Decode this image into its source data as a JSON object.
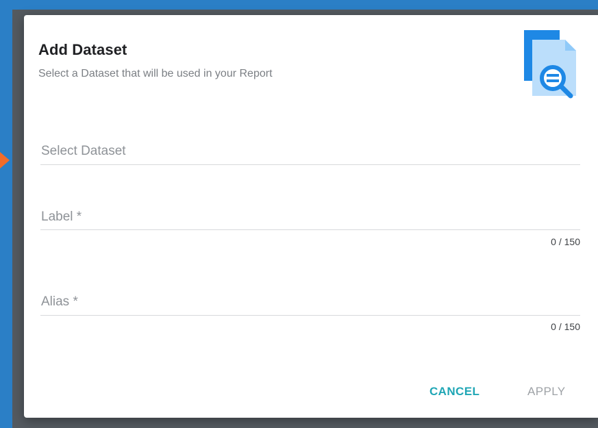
{
  "dialog": {
    "title": "Add Dataset",
    "subtitle": "Select a Dataset that will be used in your Report",
    "icon": "dataset-search-icon"
  },
  "fields": {
    "dataset": {
      "placeholder": "Select Dataset",
      "value": ""
    },
    "label": {
      "placeholder": "Label *",
      "value": "",
      "counter": "0 / 150"
    },
    "alias": {
      "placeholder": "Alias *",
      "value": "",
      "counter": "0 / 150"
    }
  },
  "actions": {
    "cancel_label": "CANCEL",
    "apply_label": "APPLY"
  },
  "colors": {
    "accent": "#1fa6b5",
    "disabled": "#9ea2a6",
    "icon_blue": "#1e88e5",
    "background_blue": "#2b7fc6",
    "background_orange": "#f26c2a"
  }
}
